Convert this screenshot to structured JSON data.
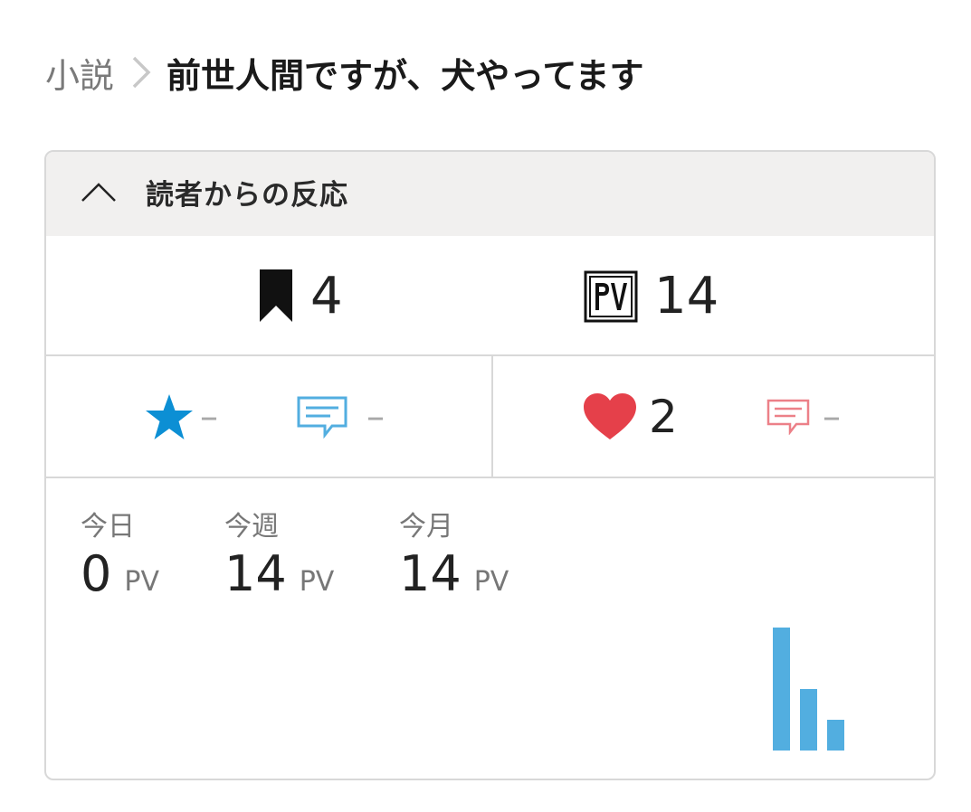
{
  "breadcrumb": {
    "parent": "小説",
    "title": "前世人間ですが、犬やってます"
  },
  "panel": {
    "title": "読者からの反応",
    "bookmarks": "4",
    "pv_total": "14",
    "rating": "–",
    "review": "–",
    "likes": "2",
    "comments": "–"
  },
  "pv": {
    "unit": "PV",
    "today": {
      "label": "今日",
      "value": "0"
    },
    "week": {
      "label": "今週",
      "value": "14"
    },
    "month": {
      "label": "今月",
      "value": "14"
    }
  },
  "colors": {
    "accent_blue": "#0c8fd4",
    "heart_red": "#e5404a",
    "bar_blue": "#52aee0"
  },
  "chart_data": {
    "type": "bar",
    "values": [
      14,
      7,
      3.5
    ]
  }
}
